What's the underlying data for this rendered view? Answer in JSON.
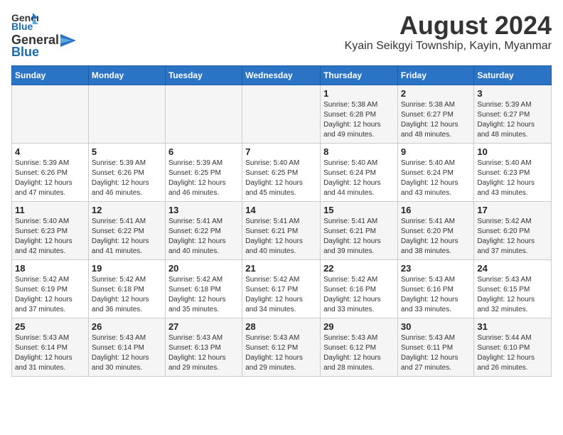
{
  "logo": {
    "general": "General",
    "blue": "Blue"
  },
  "title": {
    "month": "August 2024",
    "location": "Kyain Seikgyi Township, Kayin, Myanmar"
  },
  "headers": [
    "Sunday",
    "Monday",
    "Tuesday",
    "Wednesday",
    "Thursday",
    "Friday",
    "Saturday"
  ],
  "weeks": [
    [
      {
        "day": "",
        "info": ""
      },
      {
        "day": "",
        "info": ""
      },
      {
        "day": "",
        "info": ""
      },
      {
        "day": "",
        "info": ""
      },
      {
        "day": "1",
        "info": "Sunrise: 5:38 AM\nSunset: 6:28 PM\nDaylight: 12 hours\nand 49 minutes."
      },
      {
        "day": "2",
        "info": "Sunrise: 5:38 AM\nSunset: 6:27 PM\nDaylight: 12 hours\nand 48 minutes."
      },
      {
        "day": "3",
        "info": "Sunrise: 5:39 AM\nSunset: 6:27 PM\nDaylight: 12 hours\nand 48 minutes."
      }
    ],
    [
      {
        "day": "4",
        "info": "Sunrise: 5:39 AM\nSunset: 6:26 PM\nDaylight: 12 hours\nand 47 minutes."
      },
      {
        "day": "5",
        "info": "Sunrise: 5:39 AM\nSunset: 6:26 PM\nDaylight: 12 hours\nand 46 minutes."
      },
      {
        "day": "6",
        "info": "Sunrise: 5:39 AM\nSunset: 6:25 PM\nDaylight: 12 hours\nand 46 minutes."
      },
      {
        "day": "7",
        "info": "Sunrise: 5:40 AM\nSunset: 6:25 PM\nDaylight: 12 hours\nand 45 minutes."
      },
      {
        "day": "8",
        "info": "Sunrise: 5:40 AM\nSunset: 6:24 PM\nDaylight: 12 hours\nand 44 minutes."
      },
      {
        "day": "9",
        "info": "Sunrise: 5:40 AM\nSunset: 6:24 PM\nDaylight: 12 hours\nand 43 minutes."
      },
      {
        "day": "10",
        "info": "Sunrise: 5:40 AM\nSunset: 6:23 PM\nDaylight: 12 hours\nand 43 minutes."
      }
    ],
    [
      {
        "day": "11",
        "info": "Sunrise: 5:40 AM\nSunset: 6:23 PM\nDaylight: 12 hours\nand 42 minutes."
      },
      {
        "day": "12",
        "info": "Sunrise: 5:41 AM\nSunset: 6:22 PM\nDaylight: 12 hours\nand 41 minutes."
      },
      {
        "day": "13",
        "info": "Sunrise: 5:41 AM\nSunset: 6:22 PM\nDaylight: 12 hours\nand 40 minutes."
      },
      {
        "day": "14",
        "info": "Sunrise: 5:41 AM\nSunset: 6:21 PM\nDaylight: 12 hours\nand 40 minutes."
      },
      {
        "day": "15",
        "info": "Sunrise: 5:41 AM\nSunset: 6:21 PM\nDaylight: 12 hours\nand 39 minutes."
      },
      {
        "day": "16",
        "info": "Sunrise: 5:41 AM\nSunset: 6:20 PM\nDaylight: 12 hours\nand 38 minutes."
      },
      {
        "day": "17",
        "info": "Sunrise: 5:42 AM\nSunset: 6:20 PM\nDaylight: 12 hours\nand 37 minutes."
      }
    ],
    [
      {
        "day": "18",
        "info": "Sunrise: 5:42 AM\nSunset: 6:19 PM\nDaylight: 12 hours\nand 37 minutes."
      },
      {
        "day": "19",
        "info": "Sunrise: 5:42 AM\nSunset: 6:18 PM\nDaylight: 12 hours\nand 36 minutes."
      },
      {
        "day": "20",
        "info": "Sunrise: 5:42 AM\nSunset: 6:18 PM\nDaylight: 12 hours\nand 35 minutes."
      },
      {
        "day": "21",
        "info": "Sunrise: 5:42 AM\nSunset: 6:17 PM\nDaylight: 12 hours\nand 34 minutes."
      },
      {
        "day": "22",
        "info": "Sunrise: 5:42 AM\nSunset: 6:16 PM\nDaylight: 12 hours\nand 33 minutes."
      },
      {
        "day": "23",
        "info": "Sunrise: 5:43 AM\nSunset: 6:16 PM\nDaylight: 12 hours\nand 33 minutes."
      },
      {
        "day": "24",
        "info": "Sunrise: 5:43 AM\nSunset: 6:15 PM\nDaylight: 12 hours\nand 32 minutes."
      }
    ],
    [
      {
        "day": "25",
        "info": "Sunrise: 5:43 AM\nSunset: 6:14 PM\nDaylight: 12 hours\nand 31 minutes."
      },
      {
        "day": "26",
        "info": "Sunrise: 5:43 AM\nSunset: 6:14 PM\nDaylight: 12 hours\nand 30 minutes."
      },
      {
        "day": "27",
        "info": "Sunrise: 5:43 AM\nSunset: 6:13 PM\nDaylight: 12 hours\nand 29 minutes."
      },
      {
        "day": "28",
        "info": "Sunrise: 5:43 AM\nSunset: 6:12 PM\nDaylight: 12 hours\nand 29 minutes."
      },
      {
        "day": "29",
        "info": "Sunrise: 5:43 AM\nSunset: 6:12 PM\nDaylight: 12 hours\nand 28 minutes."
      },
      {
        "day": "30",
        "info": "Sunrise: 5:43 AM\nSunset: 6:11 PM\nDaylight: 12 hours\nand 27 minutes."
      },
      {
        "day": "31",
        "info": "Sunrise: 5:44 AM\nSunset: 6:10 PM\nDaylight: 12 hours\nand 26 minutes."
      }
    ]
  ]
}
